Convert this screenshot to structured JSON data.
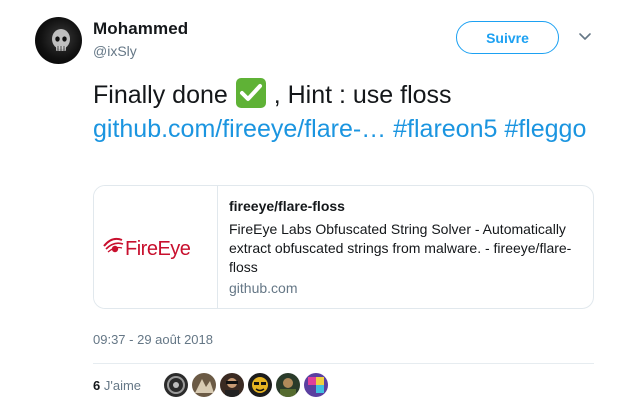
{
  "user": {
    "name": "Mohammed",
    "handle": "@ixSly"
  },
  "follow": {
    "label": "Suivre"
  },
  "tweet": {
    "text_before_emoji": "Finally done ",
    "text_after_emoji": " , Hint : use floss",
    "link_text": "github.com/fireeye/flare-…",
    "hashtag_1": "#flareon5",
    "hashtag_2": "#fleggo"
  },
  "card": {
    "image_brand": "FireEye",
    "title": "fireeye/flare-floss",
    "description": "FireEye Labs Obfuscated String Solver - Automatically extract obfuscated strings from malware. - fireeye/flare-floss",
    "domain": "github.com"
  },
  "timestamp": "09:37 - 29 août 2018",
  "likes": {
    "count": "6",
    "label": "J'aime"
  },
  "likers_count": 6,
  "colors": {
    "link": "#1b95e0",
    "follow_border": "#1da1f2",
    "emoji_check_bg": "#5fb236",
    "brand_red": "#c8102e"
  },
  "icons": {
    "caret": "chevron-down-icon",
    "emoji": "check-mark-button-emoji-icon"
  }
}
